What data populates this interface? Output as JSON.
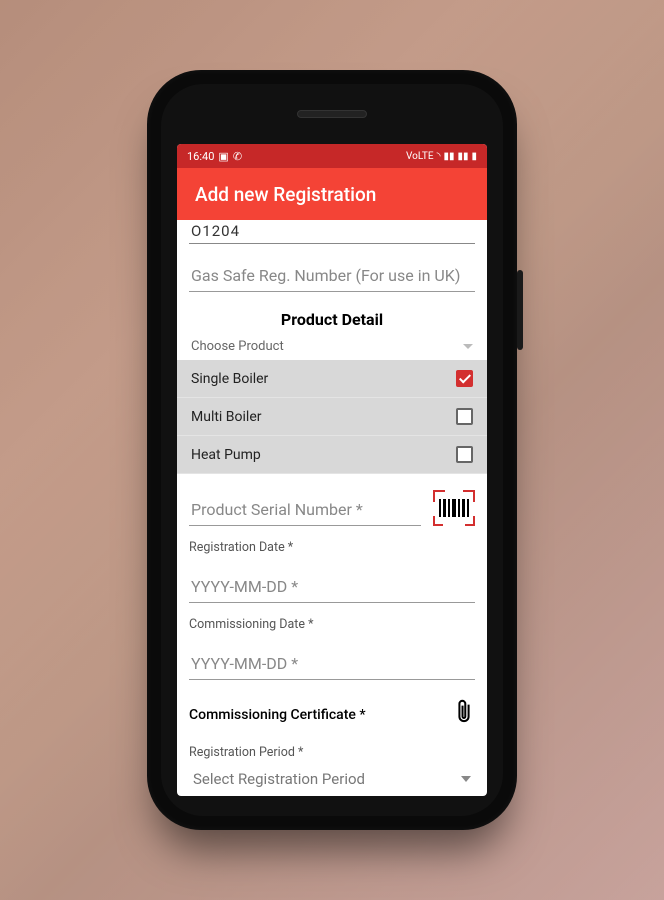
{
  "status": {
    "time": "16:40",
    "network_label": "VoLTE"
  },
  "app_bar": {
    "title": "Add new Registration"
  },
  "top_cut_value": "O1204",
  "gas_safe": {
    "placeholder": "Gas Safe Reg. Number (For use in UK)"
  },
  "section": {
    "title": "Product Detail",
    "choose_label": "Choose  Product"
  },
  "products": [
    {
      "label": "Single Boiler",
      "checked": true
    },
    {
      "label": "Multi Boiler",
      "checked": false
    },
    {
      "label": "Heat Pump",
      "checked": false
    }
  ],
  "serial": {
    "placeholder": "Product Serial Number *"
  },
  "reg_date": {
    "label": "Registration Date *",
    "placeholder": "YYYY-MM-DD *"
  },
  "comm_date": {
    "label": "Commissioning Date *",
    "placeholder": "YYYY-MM-DD *"
  },
  "certificate": {
    "label": "Commissioning Certificate  *"
  },
  "period": {
    "label": "Registration Period *",
    "placeholder": "Select Registration Period"
  }
}
